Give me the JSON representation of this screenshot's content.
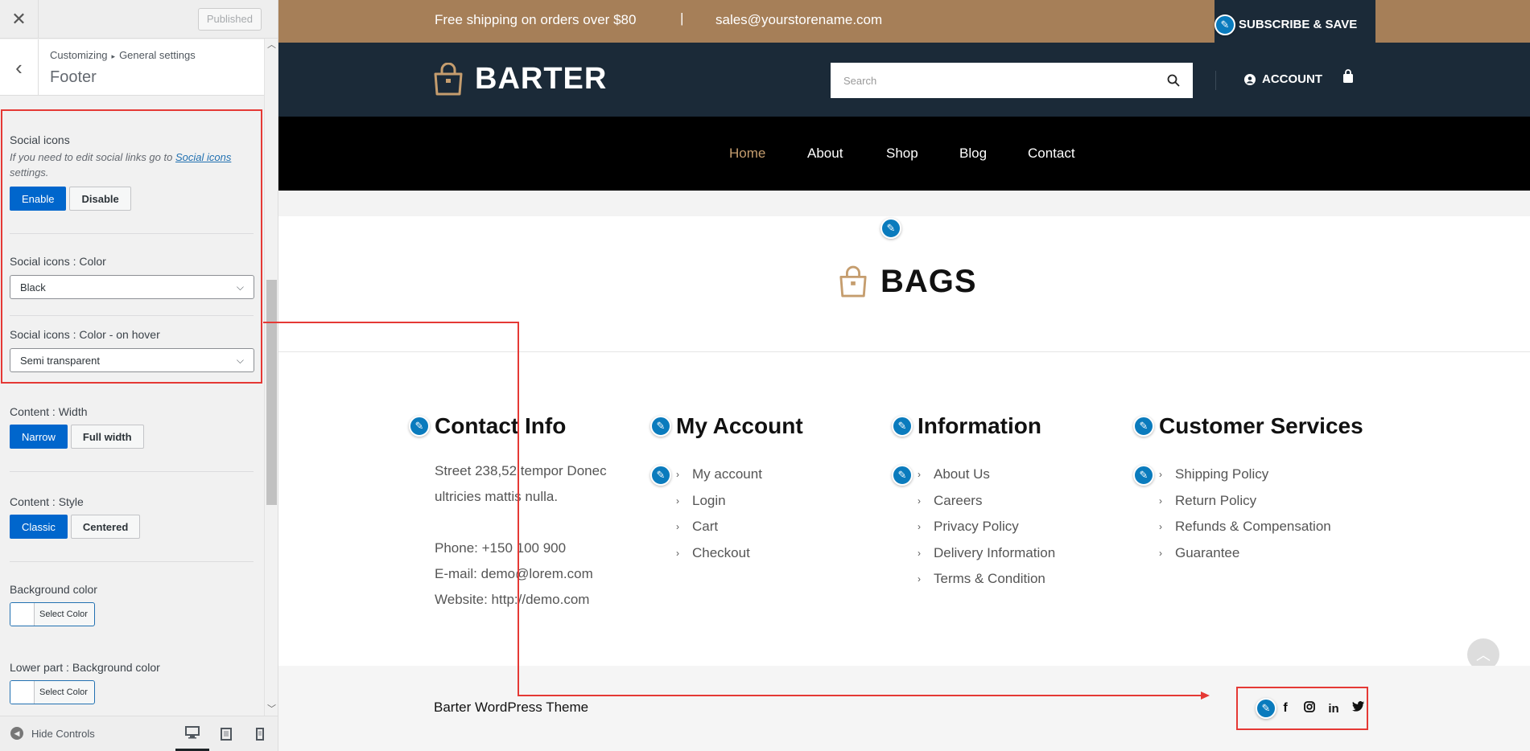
{
  "customizer": {
    "close_icon": "✕",
    "published_label": "Published",
    "back_icon": "‹",
    "breadcrumb": {
      "root": "Customizing",
      "arrow": "▸",
      "parent": "General settings"
    },
    "section_title": "Footer",
    "social_icons": {
      "label": "Social icons",
      "desc_before": "If you need to edit social links go to ",
      "desc_link": "Social icons",
      "desc_after": " settings.",
      "enable_label": "Enable",
      "disable_label": "Disable",
      "selected": "Enable"
    },
    "social_color": {
      "label": "Social icons : Color",
      "value": "Black"
    },
    "social_hover": {
      "label": "Social icons : Color - on hover",
      "value": "Semi transparent"
    },
    "content_width": {
      "label": "Content : Width",
      "opt1": "Narrow",
      "opt2": "Full width",
      "selected": "Narrow"
    },
    "content_style": {
      "label": "Content : Style",
      "opt1": "Classic",
      "opt2": "Centered",
      "selected": "Classic"
    },
    "bg_color": {
      "label": "Background color",
      "button": "Select Color"
    },
    "lower_bg_color": {
      "label": "Lower part : Background color",
      "button": "Select Color"
    },
    "hide_controls_label": "Hide Controls",
    "highlight_color": "#e53935",
    "accent_color": "#0066cc"
  },
  "preview": {
    "topbar": {
      "shipping_text": "Free shipping on orders over $80",
      "separator": "|",
      "email": "sales@yourstorename.com",
      "subscribe_label": "SUBSCRIBE & SAVE",
      "bg_color": "#a67f58"
    },
    "header": {
      "logo_text": "BARTER",
      "search_placeholder": "Search",
      "account_label": "ACCOUNT",
      "bg_color": "#1b2a38"
    },
    "nav": {
      "items": [
        "Home",
        "About",
        "Shop",
        "Blog",
        "Contact"
      ],
      "current": "Home",
      "current_color": "#c59d6e"
    },
    "footer_brand": "BAGS",
    "contact": {
      "title": "Contact Info",
      "address_line1": "Street 238,52 tempor Donec",
      "address_line2": "ultricies mattis nulla.",
      "phone": "Phone: +150 100 900",
      "email": "E-mail: demo@lorem.com",
      "website": "Website: http://demo.com"
    },
    "my_account": {
      "title": "My Account",
      "links": [
        "My account",
        "Login",
        "Cart",
        "Checkout"
      ]
    },
    "information": {
      "title": "Information",
      "links": [
        "About Us",
        "Careers",
        "Privacy Policy",
        "Delivery Information",
        "Terms & Condition"
      ]
    },
    "customer_services": {
      "title": "Customer Services",
      "links": [
        "Shipping Policy",
        "Return Policy",
        "Refunds & Compensation",
        "Guarantee"
      ]
    },
    "lower": {
      "copyright": "Barter WordPress Theme",
      "social_icons": [
        "facebook-icon",
        "instagram-icon",
        "linkedin-icon",
        "twitter-icon"
      ]
    },
    "edit_shortcut_color": "#0a7bbd"
  }
}
